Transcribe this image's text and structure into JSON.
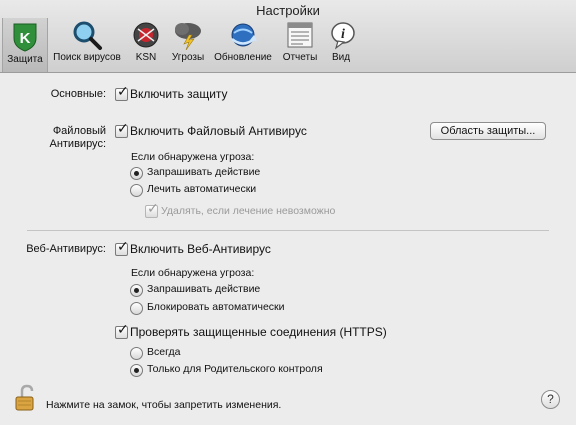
{
  "window": {
    "title": "Настройки"
  },
  "toolbar": {
    "items": [
      {
        "label": "Защита",
        "icon": "shield-k-icon"
      },
      {
        "label": "Поиск вирусов",
        "icon": "magnifier-icon"
      },
      {
        "label": "KSN",
        "icon": "ksn-globe-icon"
      },
      {
        "label": "Угрозы",
        "icon": "threat-cloud-icon"
      },
      {
        "label": "Обновление",
        "icon": "update-globe-icon"
      },
      {
        "label": "Отчеты",
        "icon": "reports-icon"
      },
      {
        "label": "Вид",
        "icon": "info-bubble-icon"
      }
    ]
  },
  "general": {
    "label": "Основные:",
    "enable_protection": {
      "label": "Включить защиту",
      "checked": true
    }
  },
  "file_av": {
    "label_line1": "Файловый",
    "label_line2": "Антивирус:",
    "enable": {
      "label": "Включить Файловый Антивирус",
      "checked": true
    },
    "scope_button": "Область защиты...",
    "threat_heading": "Если обнаружена угроза:",
    "options": [
      "Запрашивать действие",
      "Лечить автоматически"
    ],
    "selected": "Запрашивать действие",
    "delete_if_fail": {
      "label": "Удалять, если лечение невозможно",
      "checked": true,
      "disabled": true
    }
  },
  "web_av": {
    "label": "Веб-Антивирус:",
    "enable": {
      "label": "Включить Веб-Антивирус",
      "checked": true
    },
    "threat_heading": "Если обнаружена угроза:",
    "options": [
      "Запрашивать действие",
      "Блокировать автоматически"
    ],
    "selected": "Запрашивать действие",
    "https": {
      "label": "Проверять защищенные соединения (HTTPS)",
      "checked": true
    },
    "https_options": [
      "Всегда",
      "Только для Родительского контроля"
    ],
    "https_selected": "Только для Родительского контроля"
  },
  "footer": {
    "lock_text": "Нажмите на замок, чтобы запретить изменения.",
    "help": "?"
  },
  "colors": {
    "lock_gold": "#d9a441",
    "shield_green": "#2f8f3a",
    "ksn_red": "#c8262f"
  }
}
